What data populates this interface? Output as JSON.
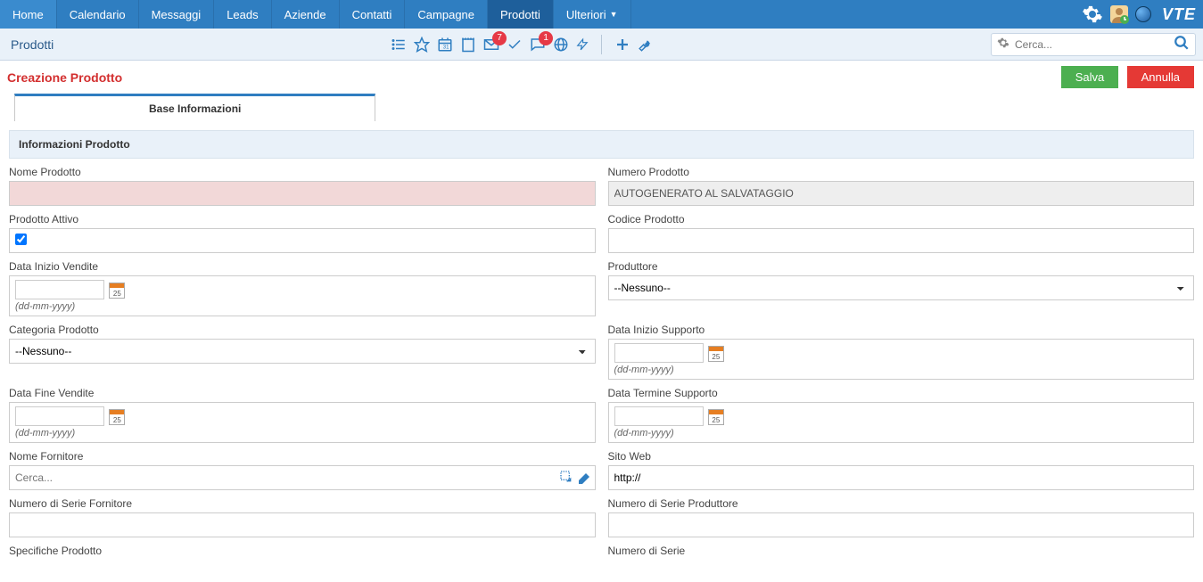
{
  "nav": {
    "items": [
      {
        "label": "Home"
      },
      {
        "label": "Calendario"
      },
      {
        "label": "Messaggi"
      },
      {
        "label": "Leads"
      },
      {
        "label": "Aziende"
      },
      {
        "label": "Contatti"
      },
      {
        "label": "Campagne"
      },
      {
        "label": "Prodotti",
        "active": true
      },
      {
        "label": "Ulteriori",
        "dropdown": true
      }
    ],
    "logo": "VTE"
  },
  "subnav": {
    "module": "Prodotti",
    "badge_mail": "7",
    "badge_chat": "1",
    "search_placeholder": "Cerca..."
  },
  "page": {
    "title": "Creazione Prodotto",
    "save": "Salva",
    "cancel": "Annulla",
    "tab": "Base Informazioni",
    "section": "Informazioni Prodotto"
  },
  "fields": {
    "nome_prodotto": {
      "label": "Nome Prodotto",
      "value": ""
    },
    "numero_prodotto": {
      "label": "Numero Prodotto",
      "value": "AUTOGENERATO AL SALVATAGGIO"
    },
    "prodotto_attivo": {
      "label": "Prodotto Attivo"
    },
    "codice_prodotto": {
      "label": "Codice Prodotto",
      "value": ""
    },
    "data_inizio_vendite": {
      "label": "Data Inizio Vendite",
      "hint": "(dd-mm-yyyy)"
    },
    "produttore": {
      "label": "Produttore",
      "value": "--Nessuno--"
    },
    "categoria_prodotto": {
      "label": "Categoria Prodotto",
      "value": "--Nessuno--"
    },
    "data_inizio_supporto": {
      "label": "Data Inizio Supporto",
      "hint": "(dd-mm-yyyy)"
    },
    "data_fine_vendite": {
      "label": "Data Fine Vendite",
      "hint": "(dd-mm-yyyy)"
    },
    "data_termine_supporto": {
      "label": "Data Termine Supporto",
      "hint": "(dd-mm-yyyy)"
    },
    "nome_fornitore": {
      "label": "Nome Fornitore",
      "placeholder": "Cerca..."
    },
    "sito_web": {
      "label": "Sito Web",
      "value": "http://"
    },
    "numero_serie_fornitore": {
      "label": "Numero di Serie Fornitore",
      "value": ""
    },
    "numero_serie_produttore": {
      "label": "Numero di Serie Produttore",
      "value": ""
    },
    "specifiche_prodotto": {
      "label": "Specifiche Prodotto"
    },
    "numero_serie": {
      "label": "Numero di Serie"
    }
  }
}
